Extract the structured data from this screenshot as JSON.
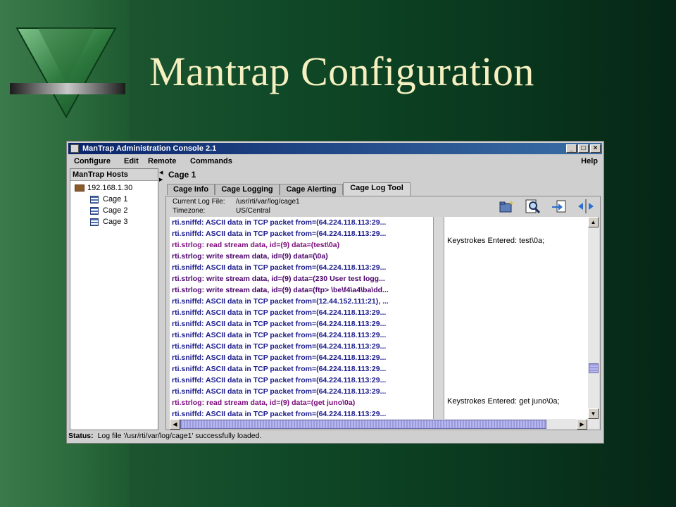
{
  "slide": {
    "title": "Mantrap Configuration"
  },
  "window": {
    "title": "ManTrap Administration Console 2.1",
    "controls": [
      "_",
      "□",
      "×"
    ]
  },
  "menu": {
    "configure": "Configure",
    "edit": "Edit",
    "remote": "Remote",
    "commands": "Commands",
    "help": "Help"
  },
  "hosts": {
    "header": "ManTrap Hosts",
    "host": "192.168.1.30",
    "cages": [
      "Cage 1",
      "Cage 2",
      "Cage 3"
    ]
  },
  "cage": {
    "title": "Cage 1",
    "tabs": [
      "Cage Info",
      "Cage Logging",
      "Cage Alerting",
      "Cage Log Tool"
    ],
    "active_tab": "Cage Log Tool",
    "current_log_label": "Current Log File:",
    "current_log_value": "/usr/rti/var/log/cage1",
    "timezone_label": "Timezone:",
    "timezone_value": "US/Central"
  },
  "toolbar_icons": [
    "open-log-icon",
    "search-log-icon",
    "import-icon",
    "expand-icon"
  ],
  "log_lines": [
    "rti.sniffd: ASCII data in TCP packet from=(64.224.118.113:29...",
    "rti.sniffd: ASCII data in TCP packet from=(64.224.118.113:29...",
    "rti.strlog: read stream data, id=(9) data=(test\\0a)",
    "rti.strlog: write stream data, id=(9) data=(\\0a)",
    "rti.sniffd: ASCII data in TCP packet from=(64.224.118.113:29...",
    "rti.strlog: write stream data, id=(9) data=(230 User test logg...",
    "rti.strlog: write stream data, id=(9) data=(ftp> \\be\\f4\\a4\\ba\\dd...",
    "rti.sniffd: ASCII data in TCP packet from=(12.44.152.111:21), ...",
    "rti.sniffd: ASCII data in TCP packet from=(64.224.118.113:29...",
    "rti.sniffd: ASCII data in TCP packet from=(64.224.118.113:29...",
    "rti.sniffd: ASCII data in TCP packet from=(64.224.118.113:29...",
    "rti.sniffd: ASCII data in TCP packet from=(64.224.118.113:29...",
    "rti.sniffd: ASCII data in TCP packet from=(64.224.118.113:29...",
    "rti.sniffd: ASCII data in TCP packet from=(64.224.118.113:29...",
    "rti.sniffd: ASCII data in TCP packet from=(64.224.118.113:29...",
    "rti.sniffd: ASCII data in TCP packet from=(64.224.118.113:29...",
    "rti.strlog: read stream data, id=(9) data=(get juno\\0a)",
    "rti.sniffd: ASCII data in TCP packet from=(64.224.118.113:29..."
  ],
  "keystrokes": [
    "Keystrokes Entered: test\\0a;",
    "Keystrokes Entered: get juno\\0a;"
  ],
  "status": {
    "label": "Status:",
    "text": "Log file '/usr/rti/var/log/cage1' successfully loaded."
  }
}
